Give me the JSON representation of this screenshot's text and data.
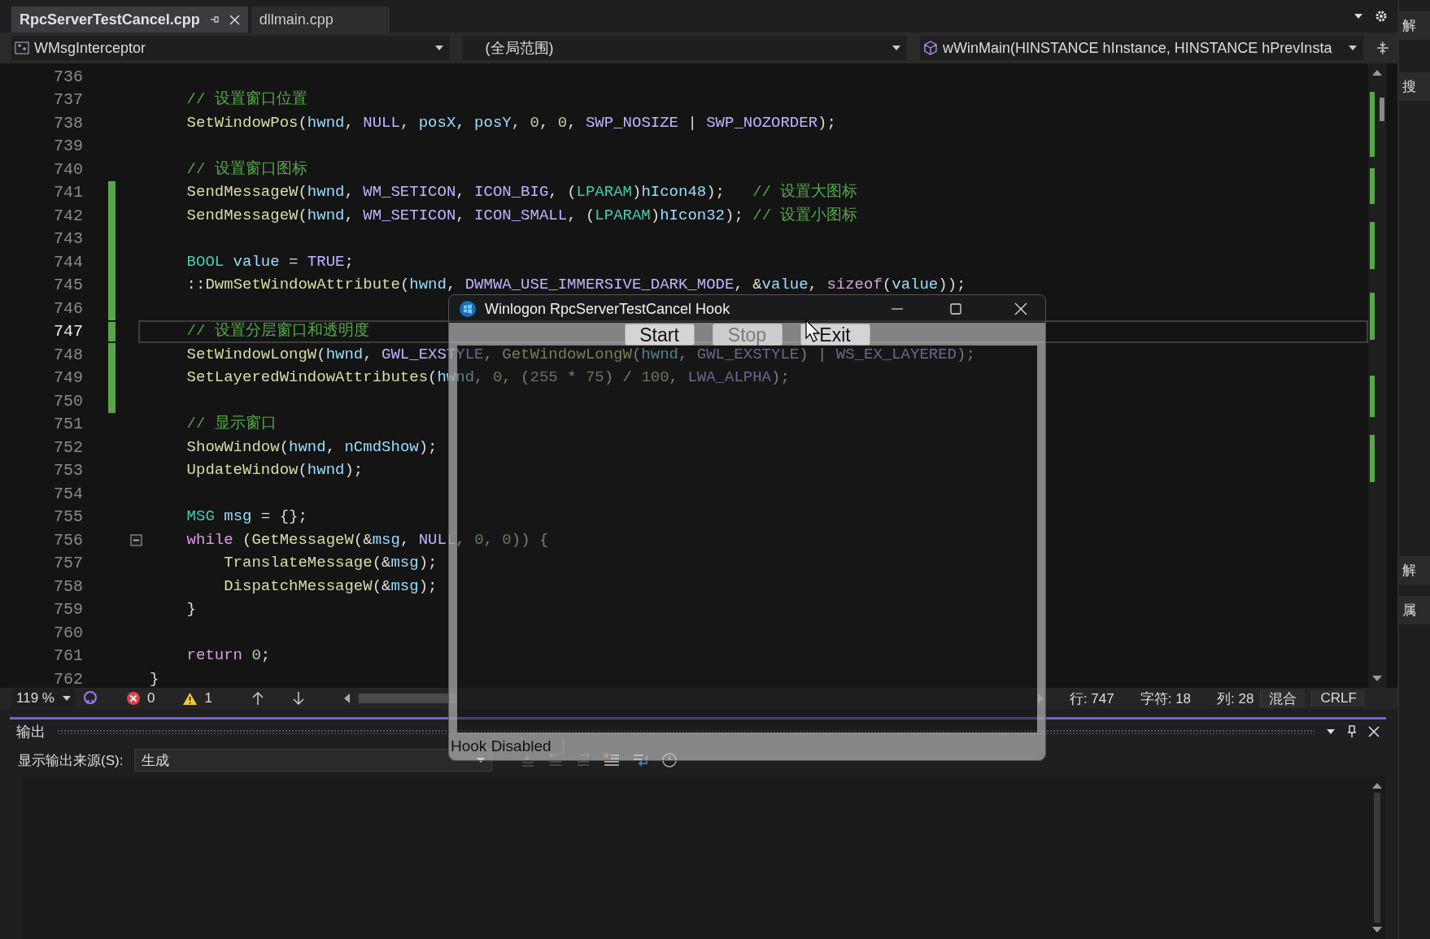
{
  "tabs": [
    {
      "label": "RpcServerTestCancel.cpp",
      "selected": true
    },
    {
      "label": "dllmain.cpp",
      "selected": false
    }
  ],
  "nav": {
    "project": "WMsgInterceptor",
    "scope": "(全局范围)",
    "member": "wWinMain(HINSTANCE hInstance, HINSTANCE hPrevInsta"
  },
  "editor": {
    "lines": [
      {
        "number": "736",
        "changed": false,
        "current": false
      },
      {
        "number": "737",
        "changed": false,
        "current": false,
        "tokens": [
          {
            "kind": "comment",
            "text": "    // 设置窗口位置"
          }
        ]
      },
      {
        "number": "738",
        "changed": false,
        "current": false,
        "tokens": [
          {
            "kind": "fn",
            "text": "    SetWindowPos"
          },
          {
            "kind": "plain",
            "text": "("
          },
          {
            "kind": "param",
            "text": "hwnd"
          },
          {
            "kind": "plain",
            "text": ", "
          },
          {
            "kind": "macro",
            "text": "NULL"
          },
          {
            "kind": "plain",
            "text": ", "
          },
          {
            "kind": "param",
            "text": "posX"
          },
          {
            "kind": "plain",
            "text": ", "
          },
          {
            "kind": "param",
            "text": "posY"
          },
          {
            "kind": "plain",
            "text": ", "
          },
          {
            "kind": "num",
            "text": "0"
          },
          {
            "kind": "plain",
            "text": ", "
          },
          {
            "kind": "num",
            "text": "0"
          },
          {
            "kind": "plain",
            "text": ", "
          },
          {
            "kind": "macro",
            "text": "SWP_NOSIZE"
          },
          {
            "kind": "plain",
            "text": " | "
          },
          {
            "kind": "macro",
            "text": "SWP_NOZORDER"
          },
          {
            "kind": "plain",
            "text": ");"
          }
        ]
      },
      {
        "number": "739",
        "changed": false,
        "current": false
      },
      {
        "number": "740",
        "changed": false,
        "current": false,
        "tokens": [
          {
            "kind": "comment",
            "text": "    // 设置窗口图标"
          }
        ]
      },
      {
        "number": "741",
        "changed": true,
        "current": false,
        "tokens": [
          {
            "kind": "fn",
            "text": "    SendMessageW"
          },
          {
            "kind": "plain",
            "text": "("
          },
          {
            "kind": "param",
            "text": "hwnd"
          },
          {
            "kind": "plain",
            "text": ", "
          },
          {
            "kind": "macro",
            "text": "WM_SETICON"
          },
          {
            "kind": "plain",
            "text": ", "
          },
          {
            "kind": "macro",
            "text": "ICON_BIG"
          },
          {
            "kind": "plain",
            "text": ", ("
          },
          {
            "kind": "type",
            "text": "LPARAM"
          },
          {
            "kind": "plain",
            "text": ")"
          },
          {
            "kind": "param",
            "text": "hIcon48"
          },
          {
            "kind": "plain",
            "text": ");   "
          },
          {
            "kind": "comment",
            "text": "// 设置大图标"
          }
        ]
      },
      {
        "number": "742",
        "changed": true,
        "current": false,
        "tokens": [
          {
            "kind": "fn",
            "text": "    SendMessageW"
          },
          {
            "kind": "plain",
            "text": "("
          },
          {
            "kind": "param",
            "text": "hwnd"
          },
          {
            "kind": "plain",
            "text": ", "
          },
          {
            "kind": "macro",
            "text": "WM_SETICON"
          },
          {
            "kind": "plain",
            "text": ", "
          },
          {
            "kind": "macro",
            "text": "ICON_SMALL"
          },
          {
            "kind": "plain",
            "text": ", ("
          },
          {
            "kind": "type",
            "text": "LPARAM"
          },
          {
            "kind": "plain",
            "text": ")"
          },
          {
            "kind": "param",
            "text": "hIcon32"
          },
          {
            "kind": "plain",
            "text": "); "
          },
          {
            "kind": "comment",
            "text": "// 设置小图标"
          }
        ]
      },
      {
        "number": "743",
        "changed": true,
        "current": false
      },
      {
        "number": "744",
        "changed": true,
        "current": false,
        "tokens": [
          {
            "kind": "type",
            "text": "    BOOL"
          },
          {
            "kind": "param",
            "text": " value"
          },
          {
            "kind": "plain",
            "text": " = "
          },
          {
            "kind": "macro",
            "text": "TRUE"
          },
          {
            "kind": "plain",
            "text": ";"
          }
        ]
      },
      {
        "number": "745",
        "changed": true,
        "current": false,
        "tokens": [
          {
            "kind": "plain",
            "text": "    ::"
          },
          {
            "kind": "fn",
            "text": "DwmSetWindowAttribute"
          },
          {
            "kind": "plain",
            "text": "("
          },
          {
            "kind": "param",
            "text": "hwnd"
          },
          {
            "kind": "plain",
            "text": ", "
          },
          {
            "kind": "macro",
            "text": "DWMWA_USE_IMMERSIVE_DARK_MODE"
          },
          {
            "kind": "plain",
            "text": ", &"
          },
          {
            "kind": "param",
            "text": "value"
          },
          {
            "kind": "plain",
            "text": ", "
          },
          {
            "kind": "kw",
            "text": "sizeof"
          },
          {
            "kind": "plain",
            "text": "("
          },
          {
            "kind": "param",
            "text": "value"
          },
          {
            "kind": "plain",
            "text": "));"
          }
        ]
      },
      {
        "number": "746",
        "changed": true,
        "current": false
      },
      {
        "number": "747",
        "changed": true,
        "current": true,
        "tokens": [
          {
            "kind": "comment",
            "text": "    // 设置分层窗口和透明度"
          }
        ]
      },
      {
        "number": "748",
        "changed": true,
        "current": false,
        "tokens": [
          {
            "kind": "fn",
            "text": "    SetWindowLongW"
          },
          {
            "kind": "plain",
            "text": "("
          },
          {
            "kind": "param",
            "text": "hwnd"
          },
          {
            "kind": "plain",
            "text": ", "
          },
          {
            "kind": "macro",
            "text": "GWL_EXSTYLE"
          },
          {
            "kind": "plain",
            "text": ", "
          },
          {
            "kind": "fn",
            "text": "GetWindowLongW"
          },
          {
            "kind": "plain",
            "text": "("
          },
          {
            "kind": "param",
            "text": "hwnd"
          },
          {
            "kind": "plain",
            "text": ", "
          },
          {
            "kind": "macro",
            "text": "GWL_EXSTYLE"
          },
          {
            "kind": "plain",
            "text": ") | "
          },
          {
            "kind": "macro",
            "text": "WS_EX_LAYERED"
          },
          {
            "kind": "plain",
            "text": ");"
          }
        ]
      },
      {
        "number": "749",
        "changed": true,
        "current": false,
        "tokens": [
          {
            "kind": "fn",
            "text": "    SetLayeredWindowAttributes"
          },
          {
            "kind": "plain",
            "text": "("
          },
          {
            "kind": "param",
            "text": "hwnd"
          },
          {
            "kind": "plain",
            "text": ", "
          },
          {
            "kind": "num",
            "text": "0"
          },
          {
            "kind": "plain",
            "text": ", ("
          },
          {
            "kind": "num",
            "text": "255"
          },
          {
            "kind": "plain",
            "text": " * "
          },
          {
            "kind": "num",
            "text": "75"
          },
          {
            "kind": "plain",
            "text": ") / "
          },
          {
            "kind": "num",
            "text": "100"
          },
          {
            "kind": "plain",
            "text": ", "
          },
          {
            "kind": "macro",
            "text": "LWA_ALPHA"
          },
          {
            "kind": "plain",
            "text": ");"
          }
        ]
      },
      {
        "number": "750",
        "changed": true,
        "current": false
      },
      {
        "number": "751",
        "changed": false,
        "current": false,
        "tokens": [
          {
            "kind": "comment",
            "text": "    // 显示窗口"
          }
        ]
      },
      {
        "number": "752",
        "changed": false,
        "current": false,
        "tokens": [
          {
            "kind": "fn",
            "text": "    ShowWindow"
          },
          {
            "kind": "plain",
            "text": "("
          },
          {
            "kind": "param",
            "text": "hwnd"
          },
          {
            "kind": "plain",
            "text": ", "
          },
          {
            "kind": "param",
            "text": "nCmdShow"
          },
          {
            "kind": "plain",
            "text": ");"
          }
        ]
      },
      {
        "number": "753",
        "changed": false,
        "current": false,
        "tokens": [
          {
            "kind": "fn",
            "text": "    UpdateWindow"
          },
          {
            "kind": "plain",
            "text": "("
          },
          {
            "kind": "param",
            "text": "hwnd"
          },
          {
            "kind": "plain",
            "text": ");"
          }
        ]
      },
      {
        "number": "754",
        "changed": false,
        "current": false
      },
      {
        "number": "755",
        "changed": false,
        "current": false,
        "tokens": [
          {
            "kind": "type",
            "text": "    MSG"
          },
          {
            "kind": "param",
            "text": " msg"
          },
          {
            "kind": "plain",
            "text": " = {};"
          }
        ]
      },
      {
        "number": "756",
        "changed": false,
        "current": false,
        "fold_toggle": true,
        "tokens": [
          {
            "kind": "kw",
            "text": "    while"
          },
          {
            "kind": "plain",
            "text": " ("
          },
          {
            "kind": "fn",
            "text": "GetMessageW"
          },
          {
            "kind": "plain",
            "text": "(&"
          },
          {
            "kind": "param",
            "text": "msg"
          },
          {
            "kind": "plain",
            "text": ", "
          },
          {
            "kind": "macro",
            "text": "NULL"
          },
          {
            "kind": "plain",
            "text": ", "
          },
          {
            "kind": "num",
            "text": "0"
          },
          {
            "kind": "plain",
            "text": ", "
          },
          {
            "kind": "num",
            "text": "0"
          },
          {
            "kind": "plain",
            "text": ")) {"
          }
        ]
      },
      {
        "number": "757",
        "changed": false,
        "current": false,
        "tokens": [
          {
            "kind": "fn",
            "text": "        TranslateMessage"
          },
          {
            "kind": "plain",
            "text": "(&"
          },
          {
            "kind": "param",
            "text": "msg"
          },
          {
            "kind": "plain",
            "text": ");"
          }
        ]
      },
      {
        "number": "758",
        "changed": false,
        "current": false,
        "tokens": [
          {
            "kind": "fn",
            "text": "        DispatchMessageW"
          },
          {
            "kind": "plain",
            "text": "(&"
          },
          {
            "kind": "param",
            "text": "msg"
          },
          {
            "kind": "plain",
            "text": ");"
          }
        ]
      },
      {
        "number": "759",
        "changed": false,
        "current": false,
        "tokens": [
          {
            "kind": "plain",
            "text": "    }"
          }
        ]
      },
      {
        "number": "760",
        "changed": false,
        "current": false
      },
      {
        "number": "761",
        "changed": false,
        "current": false,
        "tokens": [
          {
            "kind": "kw",
            "text": "    return"
          },
          {
            "kind": "num",
            "text": " 0"
          },
          {
            "kind": "plain",
            "text": ";"
          }
        ]
      },
      {
        "number": "762",
        "changed": false,
        "current": false,
        "tokens": [
          {
            "kind": "plain",
            "text": "}"
          }
        ]
      }
    ]
  },
  "status_bar": {
    "zoom": "119 %",
    "errors": "0",
    "warnings": "1",
    "line": "行: 747",
    "char": "字符: 18",
    "column": "列: 28",
    "encoding": "混合",
    "line_ending": "CRLF"
  },
  "output": {
    "title": "输出",
    "source_label": "显示输出来源(S):",
    "source": "生成"
  },
  "sidebar": {
    "items": [
      "解",
      "搜",
      "解",
      "属"
    ]
  },
  "dialog": {
    "title": "Winlogon RpcServerTestCancel Hook",
    "buttons": [
      {
        "label": "Start",
        "disabled": false
      },
      {
        "label": "Stop",
        "disabled": true
      },
      {
        "label": "Exit",
        "disabled": false
      }
    ],
    "status": "Hook Disabled"
  }
}
